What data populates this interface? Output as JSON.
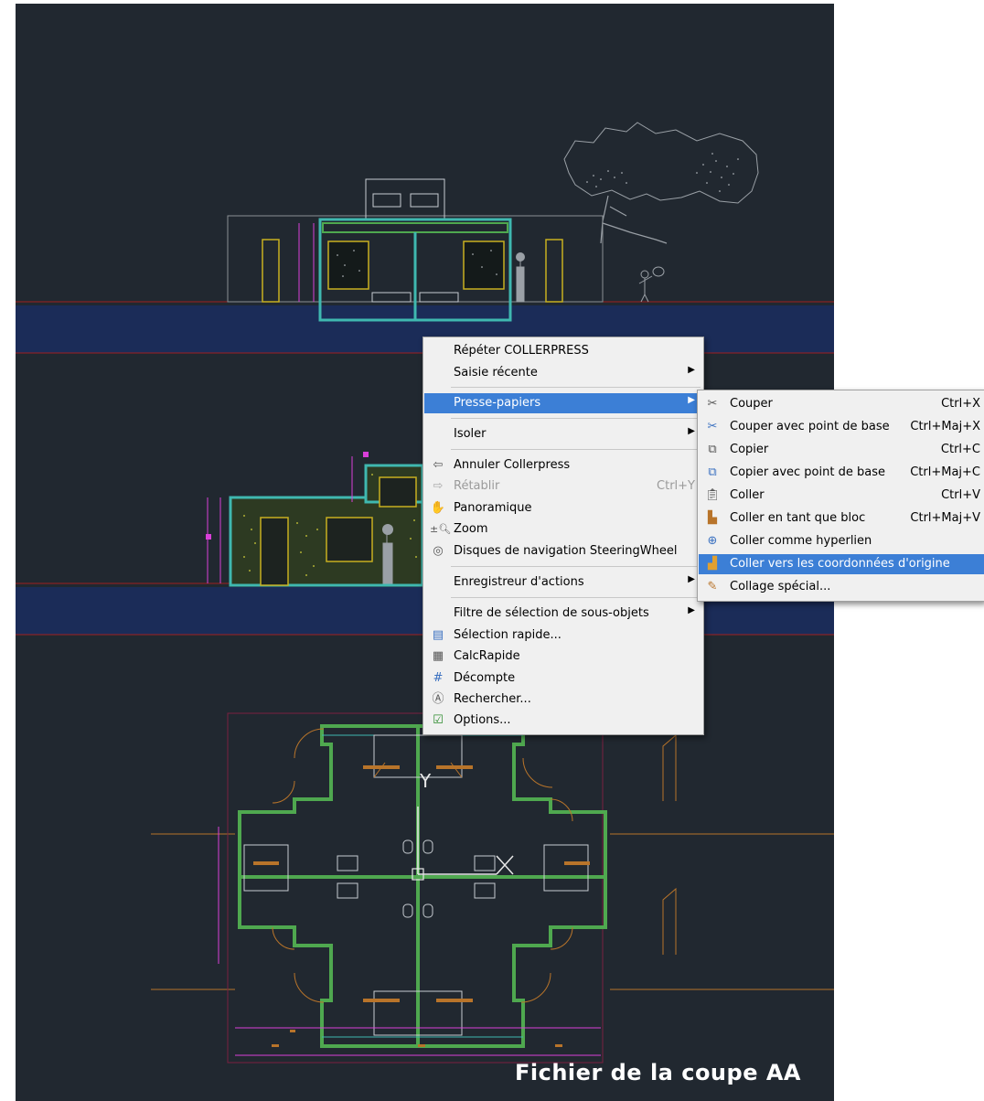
{
  "caption": "Fichier de la coupe AA",
  "context_menu": {
    "items": [
      {
        "label": "Répéter COLLERPRESS"
      },
      {
        "label": "Saisie récente",
        "submenu": true
      },
      {
        "label": "Presse-papiers",
        "submenu": true,
        "highlighted": true
      },
      {
        "label": "Isoler",
        "submenu": true
      },
      {
        "label": "Annuler Collerpress",
        "icon": "undo-icon"
      },
      {
        "label": "Rétablir",
        "shortcut": "Ctrl+Y",
        "disabled": true,
        "icon": "redo-icon"
      },
      {
        "label": "Panoramique",
        "icon": "pan-hand-icon"
      },
      {
        "label": "Zoom",
        "icon": "zoom-icon"
      },
      {
        "label": "Disques de navigation SteeringWheel",
        "icon": "steeringwheel-icon"
      },
      {
        "label": "Enregistreur d'actions",
        "submenu": true
      },
      {
        "label": "Filtre de sélection de sous-objets",
        "submenu": true
      },
      {
        "label": "Sélection rapide...",
        "icon": "quick-select-icon"
      },
      {
        "label": "CalcRapide",
        "icon": "calculator-icon"
      },
      {
        "label": "Décompte",
        "icon": "count-icon"
      },
      {
        "label": "Rechercher...",
        "icon": "find-icon"
      },
      {
        "label": "Options...",
        "icon": "options-checkbox-icon"
      }
    ]
  },
  "clipboard_submenu": {
    "items": [
      {
        "label": "Couper",
        "shortcut": "Ctrl+X",
        "icon": "cut-icon"
      },
      {
        "label": "Couper avec point de base",
        "shortcut": "Ctrl+Maj+X",
        "icon": "cut-basepoint-icon"
      },
      {
        "label": "Copier",
        "shortcut": "Ctrl+C",
        "icon": "copy-icon"
      },
      {
        "label": "Copier avec point de base",
        "shortcut": "Ctrl+Maj+C",
        "icon": "copy-basepoint-icon"
      },
      {
        "label": "Coller",
        "shortcut": "Ctrl+V",
        "icon": "paste-icon"
      },
      {
        "label": "Coller en tant que bloc",
        "shortcut": "Ctrl+Maj+V",
        "icon": "paste-block-icon"
      },
      {
        "label": "Coller comme hyperlien",
        "icon": "paste-hyperlink-icon"
      },
      {
        "label": "Coller vers les coordonnées d'origine",
        "highlighted": true,
        "icon": "paste-original-coords-icon"
      },
      {
        "label": "Collage spécial...",
        "icon": "paste-special-icon"
      }
    ]
  },
  "ucs": {
    "y_label": "Y"
  },
  "colors": {
    "canvas": "#212830",
    "ground_band": "#1b2c58",
    "highlight": "#3c7fd6",
    "wall_green": "#4fa84f",
    "wall_cyan": "#3fb8b0",
    "magenta": "#d93fd9",
    "window_yellow": "#c8b020",
    "orange_line": "#b8742a",
    "red_line": "#a02020"
  }
}
